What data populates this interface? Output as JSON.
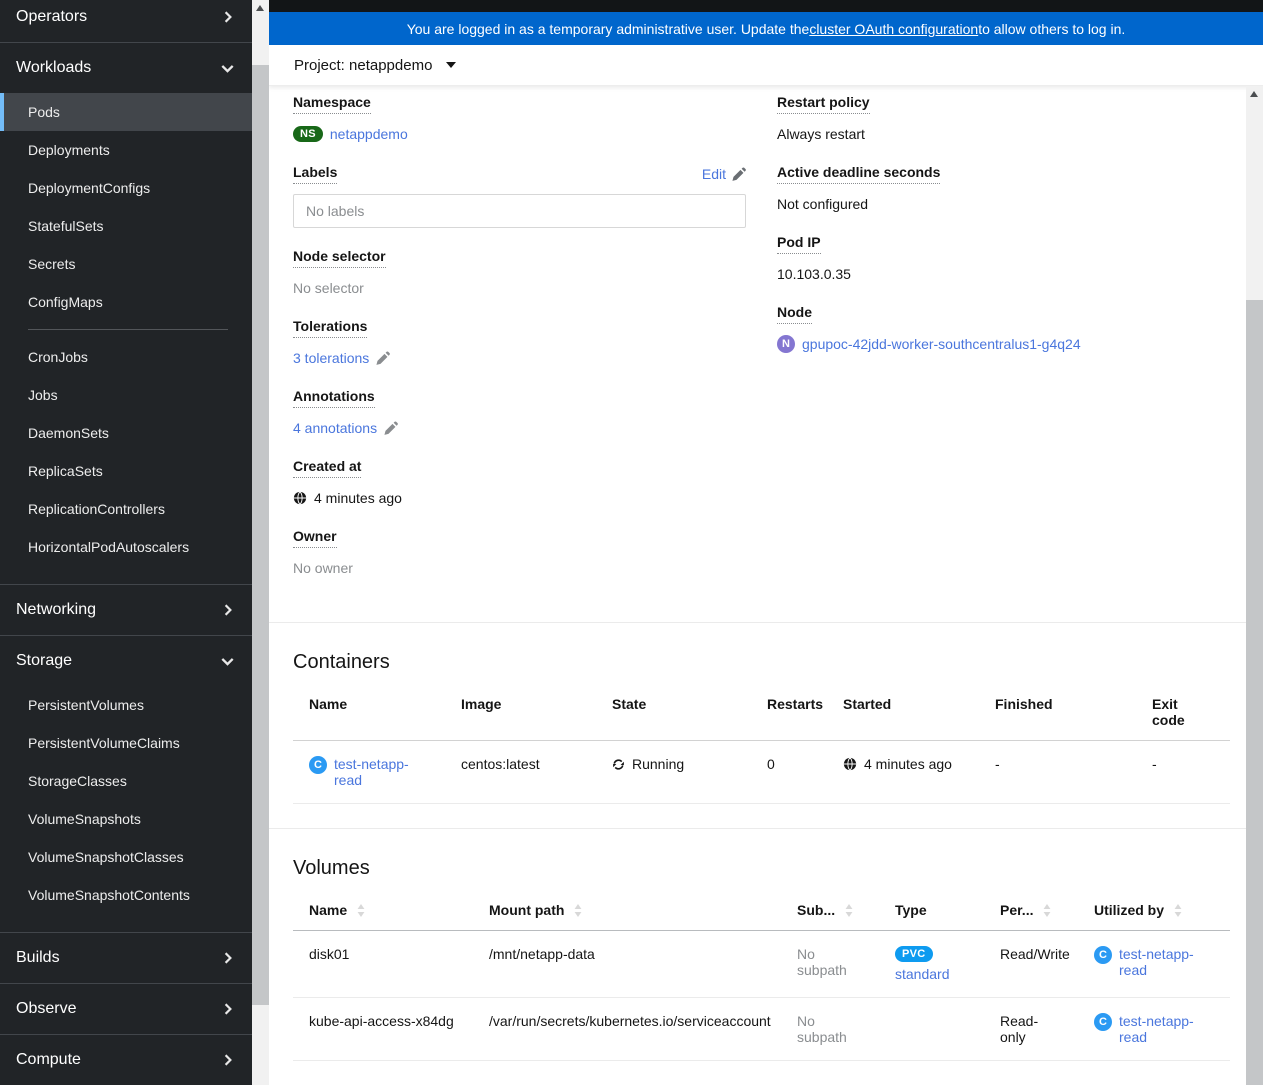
{
  "banner": {
    "prefix": "You are logged in as a temporary administrative user. Update the ",
    "link_text": "cluster OAuth configuration",
    "suffix": " to allow others to log in."
  },
  "project_bar": {
    "label": "Project: netappdemo"
  },
  "sidebar": {
    "operators": "Operators",
    "workloads": {
      "label": "Workloads",
      "items": [
        {
          "label": "Pods"
        },
        {
          "label": "Deployments"
        },
        {
          "label": "DeploymentConfigs"
        },
        {
          "label": "StatefulSets"
        },
        {
          "label": "Secrets"
        },
        {
          "label": "ConfigMaps"
        },
        {
          "label": "CronJobs"
        },
        {
          "label": "Jobs"
        },
        {
          "label": "DaemonSets"
        },
        {
          "label": "ReplicaSets"
        },
        {
          "label": "ReplicationControllers"
        },
        {
          "label": "HorizontalPodAutoscalers"
        }
      ]
    },
    "networking": "Networking",
    "storage": {
      "label": "Storage",
      "items": [
        {
          "label": "PersistentVolumes"
        },
        {
          "label": "PersistentVolumeClaims"
        },
        {
          "label": "StorageClasses"
        },
        {
          "label": "VolumeSnapshots"
        },
        {
          "label": "VolumeSnapshotClasses"
        },
        {
          "label": "VolumeSnapshotContents"
        }
      ]
    },
    "builds": "Builds",
    "observe": "Observe",
    "compute": "Compute"
  },
  "details": {
    "namespace": {
      "term": "Namespace",
      "badge": "NS",
      "value": "netappdemo"
    },
    "labels": {
      "term": "Labels",
      "edit": "Edit",
      "empty": "No labels"
    },
    "node_selector": {
      "term": "Node selector",
      "value": "No selector"
    },
    "tolerations": {
      "term": "Tolerations",
      "value": "3 tolerations"
    },
    "annotations": {
      "term": "Annotations",
      "value": "4 annotations"
    },
    "created_at": {
      "term": "Created at",
      "value": "4 minutes ago"
    },
    "owner": {
      "term": "Owner",
      "value": "No owner"
    },
    "restart_policy": {
      "term": "Restart policy",
      "value": "Always restart"
    },
    "active_deadline": {
      "term": "Active deadline seconds",
      "value": "Not configured"
    },
    "pod_ip": {
      "term": "Pod IP",
      "value": "10.103.0.35"
    },
    "node": {
      "term": "Node",
      "badge": "N",
      "value": "gpupoc-42jdd-worker-southcentralus1-g4q24"
    }
  },
  "containers": {
    "title": "Containers",
    "columns": [
      "Name",
      "Image",
      "State",
      "Restarts",
      "Started",
      "Finished",
      "Exit code"
    ],
    "rows": [
      {
        "badge": "C",
        "name": "test-netapp-read",
        "image": "centos:latest",
        "state": "Running",
        "restarts": "0",
        "started": "4 minutes ago",
        "finished": "-",
        "exit_code": "-"
      }
    ]
  },
  "volumes": {
    "title": "Volumes",
    "columns": [
      "Name",
      "Mount path",
      "Sub...",
      "Type",
      "Per...",
      "Utilized by"
    ],
    "rows": [
      {
        "name": "disk01",
        "mount_path": "/mnt/netapp-data",
        "subpath": "No subpath",
        "type_badge": "PVC",
        "type_link": "standard",
        "permissions": "Read/Write",
        "utilized_badge": "C",
        "utilized_by": "test-netapp-read"
      },
      {
        "name": "kube-api-access-x84dg",
        "mount_path": "/var/run/secrets/kubernetes.io/serviceaccount",
        "subpath": "No subpath",
        "permissions": "Read-only",
        "utilized_badge": "C",
        "utilized_by": "test-netapp-read"
      }
    ]
  },
  "icons": {
    "timestamp": "globe-icon",
    "edit": "pencil-icon",
    "running_state": "sync-icon",
    "sort": "sort-icon",
    "collapsed_section": "chevron-right-icon",
    "expanded_section": "chevron-down-icon",
    "project_dropdown": "caret-down-icon"
  },
  "colors": {
    "banner_bg": "#0066cc",
    "link": "#4a76dd",
    "sidebar_bg": "#212427",
    "nav_active_border": "#73bcf7",
    "ns_badge": "#186818",
    "container_badge": "#2b9af3",
    "pvc_badge": "#0e9bf0",
    "node_badge": "#8476d1"
  }
}
